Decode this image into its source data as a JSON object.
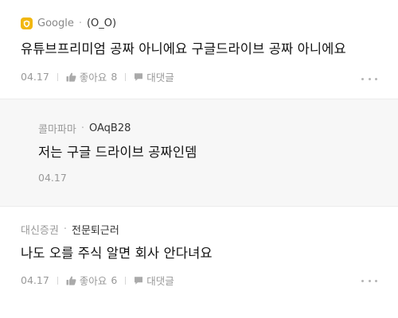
{
  "comments": [
    {
      "source": "Google",
      "nickname": "(O_O)",
      "text": "유튜브프리미엄 공짜 아니에요 구글드라이브 공짜 아니에요",
      "date": "04.17",
      "like_label": "좋아요",
      "like_count": "8",
      "reply_label": "대댓글",
      "badge_icon": "shield-badge-icon",
      "badge_color": "#f1b711"
    },
    {
      "source": "콜마파마",
      "nickname": "OAqB28",
      "text": "저는 구글 드라이브 공짜인뎀",
      "date": "04.17"
    },
    {
      "source": "대신증권",
      "nickname": "전문퇴근러",
      "text": "나도 오를 주식 알면 회사 안다녀요",
      "date": "04.17",
      "like_label": "좋아요",
      "like_count": "6",
      "reply_label": "대댓글"
    }
  ]
}
